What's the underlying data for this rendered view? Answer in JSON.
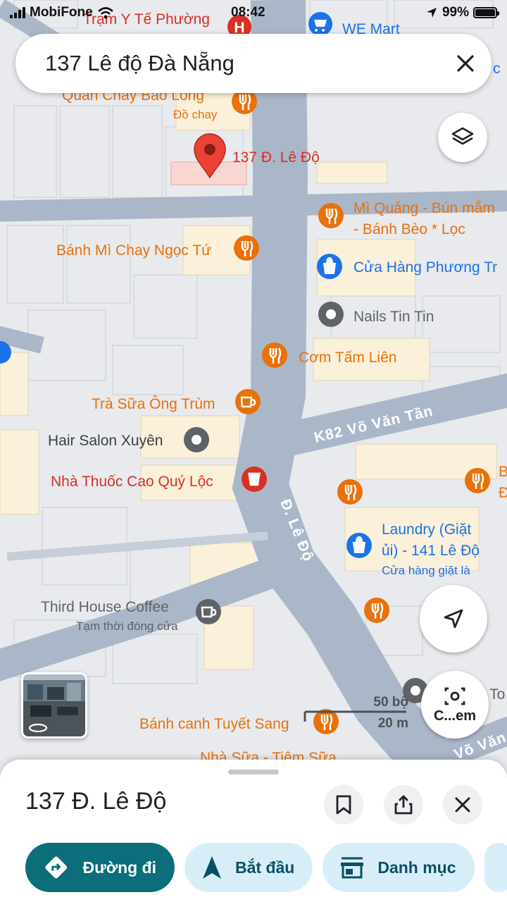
{
  "status_bar": {
    "carrier": "MobiFone",
    "time": "08:42",
    "battery": "99%",
    "battery_level": 0.99
  },
  "search": {
    "query": "137 Lê độ Đà Nẵng"
  },
  "map": {
    "pin_label": "137 Đ. Lê Độ",
    "pois": [
      {
        "name": "Trạm Y Tế Phường",
        "category": "hospital-icon",
        "color": "#d93025"
      },
      {
        "name": "WE Mart",
        "category": "shopping-cart-icon",
        "color": "#1a73e8"
      },
      {
        "name": "Quán Chay Bảo Long",
        "sub": "Đồ chay",
        "category": "restaurant-icon",
        "color": "#e8710a"
      },
      {
        "name": "Mì Quảng - Bún mắm",
        "name2": "- Bánh Bèo * Lọc",
        "category": "restaurant-icon",
        "color": "#e8710a"
      },
      {
        "name": "Bánh Mì Chay Ngọc Tứ",
        "category": "restaurant-icon",
        "color": "#e8710a"
      },
      {
        "name": "Cửa Hàng Phương Tr",
        "category": "shopping-bag-icon",
        "color": "#1a73e8"
      },
      {
        "name": "Nails Tin Tin",
        "category": "place-icon",
        "color": "#5f6368"
      },
      {
        "name": "Cơm Tấm Liên",
        "category": "restaurant-icon",
        "color": "#e8710a"
      },
      {
        "name": "Trà Sữa Ông Trùm",
        "category": "cafe-icon",
        "color": "#e8710a"
      },
      {
        "name": "Hair Salon Xuyên",
        "category": "place-icon",
        "color": "#5f6368"
      },
      {
        "name": "Nhà Thuốc Cao Quý Lộc",
        "category": "pharmacy-icon",
        "color": "#d93025"
      },
      {
        "name": "Laundry (Giặt",
        "name2": "ủi) - 141 Lê Độ",
        "sub": "Cửa hàng giặt là",
        "category": "shopping-bag-icon",
        "color": "#1a73e8"
      },
      {
        "name": "Third House Coffee",
        "sub": "Tạm thời đóng cửa",
        "category": "cafe-icon",
        "color": "#5f6368"
      },
      {
        "name": "Bánh canh Tuyết Sang",
        "category": "restaurant-icon",
        "color": "#e8710a"
      },
      {
        "name": "Nhà Sữa - Tiệm Sữa",
        "category": "none",
        "color": "#e8710a"
      }
    ],
    "roads": {
      "main": "Đ. Lê Độ",
      "side": "K82 Võ Văn Tần",
      "corner": "Võ Văn"
    },
    "edge_labels": {
      "right_top": "c",
      "right_b": "B",
      "right_d": "Đ",
      "right_to": "e To"
    }
  },
  "scale": {
    "imperial": "50 bộ",
    "metric": "20 m"
  },
  "camera_button": {
    "label": "C...em"
  },
  "sheet": {
    "title": "137 Đ. Lê Độ",
    "chips": [
      {
        "label": "Đường đi",
        "icon": "directions-icon"
      },
      {
        "label": "Bắt đầu",
        "icon": "navigation-arrow-icon"
      },
      {
        "label": "Danh mục",
        "icon": "store-icon"
      }
    ]
  },
  "colors": {
    "road": "#aab7c9",
    "block": "#e8eaed",
    "block_edge": "#d2d6db",
    "highlight_block": "#fbf0d9",
    "pin": "#ea4335",
    "primary": "#0b6e7a"
  }
}
